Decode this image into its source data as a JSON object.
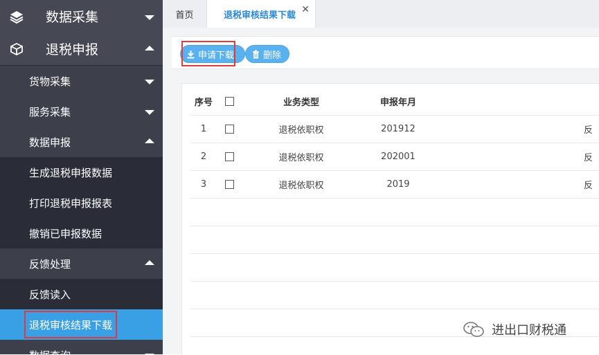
{
  "sidebar": {
    "items": [
      {
        "label": "数据采集",
        "level": "top",
        "state": "collapsed",
        "icon": "layers-icon"
      },
      {
        "label": "退税申报",
        "level": "top",
        "state": "expanded",
        "icon": "cube-icon"
      },
      {
        "label": "货物采集",
        "level": "sub",
        "state": "collapsed"
      },
      {
        "label": "服务采集",
        "level": "sub",
        "state": "collapsed"
      },
      {
        "label": "数据申报",
        "level": "sub",
        "state": "expanded"
      },
      {
        "label": "生成退税申报数据",
        "level": "leaf"
      },
      {
        "label": "打印退税申报报表",
        "level": "leaf"
      },
      {
        "label": "撤销已申报数据",
        "level": "leaf"
      },
      {
        "label": "反馈处理",
        "level": "sub",
        "state": "expanded"
      },
      {
        "label": "反馈读入",
        "level": "leaf"
      },
      {
        "label": "退税审核结果下载",
        "level": "leaf",
        "active": true
      },
      {
        "label": "数据查询",
        "level": "sub",
        "state": "collapsed"
      }
    ]
  },
  "tabs": {
    "home": "首页",
    "active": "退税审核结果下载",
    "close": "✕"
  },
  "toolbar": {
    "download_label": "申请下载",
    "delete_label": "删除"
  },
  "table": {
    "headers": {
      "index": "序号",
      "type": "业务类型",
      "year_month": "申报年月"
    },
    "rows": [
      {
        "index": "1",
        "type": "退税依职权",
        "year_month": "201912",
        "extra": "反"
      },
      {
        "index": "2",
        "type": "退税依职权",
        "year_month": "202001",
        "extra": "反"
      },
      {
        "index": "3",
        "type": "退税依职权",
        "year_month": "2019",
        "extra": "反"
      }
    ]
  },
  "watermark": {
    "text": "进出口财税通"
  },
  "colors": {
    "sidebar_bg": "#2a2d38",
    "sidebar_top_bg": "#464954",
    "sidebar_sub_bg": "#3d404b",
    "active_item": "#3aa0e6",
    "button": "#59b1f0",
    "highlight_box": "#e03a3a",
    "active_tab_text": "#2f8ad6"
  }
}
